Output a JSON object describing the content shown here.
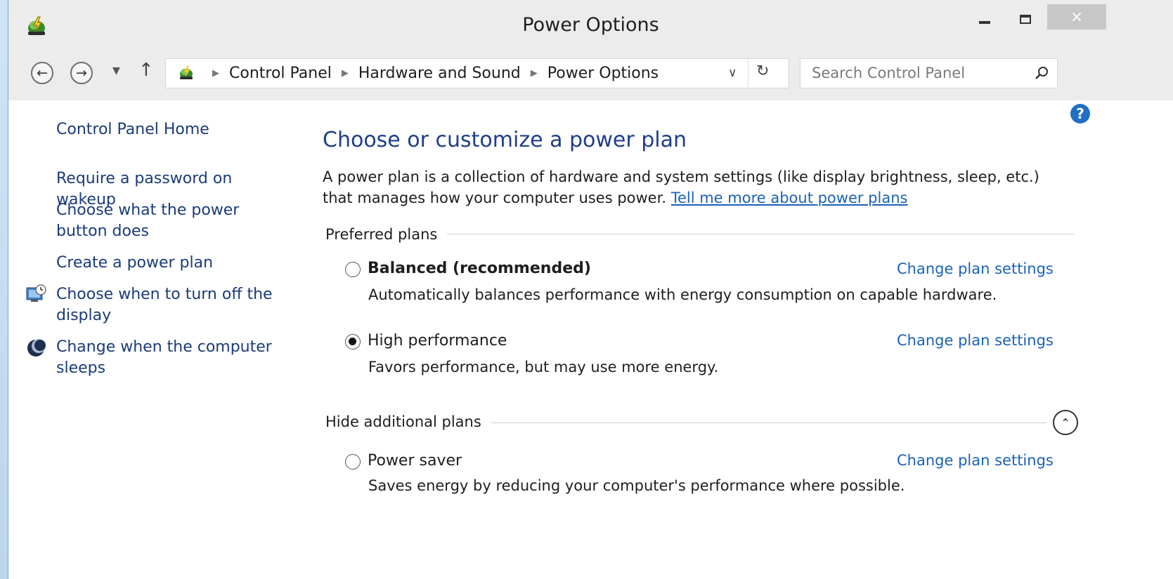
{
  "window": {
    "title": "Power Options",
    "close_label": "×"
  },
  "address": {
    "crumbs": [
      "Control Panel",
      "Hardware and Sound",
      "Power Options"
    ]
  },
  "search": {
    "placeholder": "Search Control Panel"
  },
  "help": {
    "label": "?"
  },
  "sidebar": {
    "items": [
      {
        "label": "Control Panel Home"
      },
      {
        "label": "Require a password on wakeup"
      },
      {
        "label": "Choose what the power button does"
      },
      {
        "label": "Create a power plan"
      },
      {
        "label": "Choose when to turn off the display",
        "icon": "clock-monitor-icon"
      },
      {
        "label": "Change when the computer sleeps",
        "icon": "moon-sleep-icon"
      }
    ]
  },
  "main": {
    "title": "Choose or customize a power plan",
    "description": "A power plan is a collection of hardware and system settings (like display brightness, sleep, etc.) that manages how your computer uses power.",
    "learn_more_link": "Tell me more about power plans",
    "preferred_label": "Preferred plans",
    "additional_label": "Hide additional plans",
    "change_link_label": "Change plan settings",
    "plans": [
      {
        "name": "Balanced (recommended)",
        "description": "Automatically balances performance with energy consumption on capable hardware.",
        "selected": false
      },
      {
        "name": "High performance",
        "description": "Favors performance, but may use more energy.",
        "selected": true
      },
      {
        "name": "Power saver",
        "description": "Saves energy by reducing your computer's performance where possible.",
        "selected": false
      }
    ]
  },
  "colors": {
    "link": "#1a62b8",
    "heading": "#1e3e8c",
    "sidebar_link": "#1a3b7a",
    "chrome": "#ececec"
  }
}
